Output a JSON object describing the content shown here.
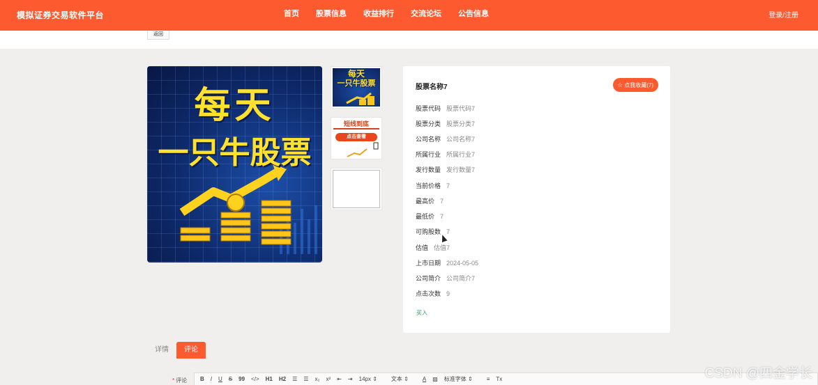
{
  "header": {
    "brand": "模拟证券交易软件平台",
    "nav": [
      "首页",
      "股票信息",
      "收益排行",
      "交流论坛",
      "公告信息"
    ],
    "login": "登录/注册",
    "accent": "#fd5a30"
  },
  "back_label": "返回",
  "main_image": {
    "line1": "每天",
    "line2": "一只牛股票"
  },
  "thumbs": {
    "a_line1": "每天",
    "a_line2": "一只牛股票",
    "b_title": "短线到底",
    "b_button": "点击查看"
  },
  "detail": {
    "title": "股票名称7",
    "fav_label": "点我收藏(7)",
    "rows": [
      {
        "k": "股票代码",
        "v": "股票代码7"
      },
      {
        "k": "股票分类",
        "v": "股票分类7"
      },
      {
        "k": "公司名称",
        "v": "公司名称7"
      },
      {
        "k": "所属行业",
        "v": "所属行业7"
      },
      {
        "k": "发行数量",
        "v": "发行数量7"
      },
      {
        "k": "当前价格",
        "v": "7"
      },
      {
        "k": "最高价",
        "v": "7"
      },
      {
        "k": "最低价",
        "v": "7"
      },
      {
        "k": "可购股数",
        "v": "7"
      },
      {
        "k": "估值",
        "v": "估值7"
      },
      {
        "k": "上市日期",
        "v": "2024-05-05"
      },
      {
        "k": "公司简介",
        "v": "公司简介7"
      },
      {
        "k": "点击次数",
        "v": "9"
      }
    ],
    "buy_label": "买入"
  },
  "tabs": [
    "详情",
    "评论"
  ],
  "editor": {
    "label": "评论",
    "toolbar": [
      "B",
      "I",
      "U",
      "S",
      "99",
      "</>",
      "H1",
      "H2",
      "☰",
      "☰",
      "x₂",
      "x²",
      "⇤",
      "⇥",
      "14px ⇕",
      "文本 ⇕",
      "A",
      "▨",
      "标准字体 ⇕",
      "≡",
      "Tx"
    ]
  },
  "watermark": "CSDN @四金学长"
}
